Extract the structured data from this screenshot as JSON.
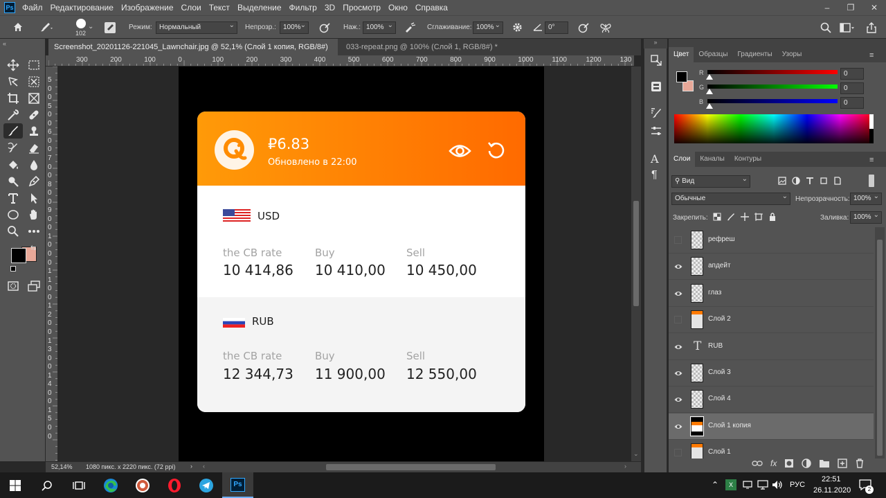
{
  "app": {
    "logo": "Ps"
  },
  "menu": [
    "Файл",
    "Редактирование",
    "Изображение",
    "Слои",
    "Текст",
    "Выделение",
    "Фильтр",
    "3D",
    "Просмотр",
    "Окно",
    "Справка"
  ],
  "options": {
    "brush_size": "102",
    "mode_label": "Режим:",
    "mode_value": "Нормальный",
    "opacity_label": "Непрозр.:",
    "opacity_value": "100%",
    "flow_label": "Наж.:",
    "flow_value": "100%",
    "smoothing_label": "Сглаживание:",
    "smoothing_value": "100%",
    "angle_value": "0°"
  },
  "tabs": [
    {
      "label": "Screenshot_20201126-221045_Lawnchair.jpg @ 52,1% (Слой 1 копия, RGB/8#) *"
    },
    {
      "label": "033-repeat.png @ 100% (Слой 1, RGB/8#) *"
    }
  ],
  "ruler": {
    "h_ticks": [
      "300",
      "200",
      "100",
      "0",
      "100",
      "200",
      "300",
      "400",
      "500",
      "600",
      "700",
      "800",
      "900",
      "1000",
      "1100",
      "1200",
      "130"
    ],
    "v_ticks": [
      "5",
      "0",
      "0",
      "5",
      "0",
      "0",
      "6",
      "0",
      "0",
      "7",
      "0",
      "0",
      "8",
      "0",
      "0",
      "9",
      "0",
      "0",
      "1",
      "0",
      "0",
      "0",
      "1",
      "1",
      "0",
      "0",
      "1",
      "2",
      "0",
      "0",
      "1",
      "3",
      "0",
      "0",
      "1",
      "4",
      "0",
      "0",
      "1",
      "5",
      "0",
      "0"
    ]
  },
  "card": {
    "rate": "₽6.83",
    "updated": "Обновлено в 22:00",
    "sections": [
      {
        "currency": "USD",
        "labels": [
          "the CB rate",
          "Buy",
          "Sell"
        ],
        "values": [
          "10 414,86",
          "10 410,00",
          "10 450,00"
        ]
      },
      {
        "currency": "RUB",
        "labels": [
          "the CB rate",
          "Buy",
          "Sell"
        ],
        "values": [
          "12 344,73",
          "11 900,00",
          "12 550,00"
        ]
      }
    ]
  },
  "status": {
    "zoom": "52,14%",
    "doc_info": "1080 пикс. x 2220 пикс. (72 ppi)"
  },
  "color_panel": {
    "tabs": [
      "Цвет",
      "Образцы",
      "Градиенты",
      "Узоры"
    ],
    "channels": [
      {
        "name": "R",
        "value": "0",
        "color": "#ff0000"
      },
      {
        "name": "G",
        "value": "0",
        "color": "#00ff00"
      },
      {
        "name": "B",
        "value": "0",
        "color": "#0000ff"
      }
    ],
    "foreground": "#000000",
    "background": "#e8a898"
  },
  "layers_panel": {
    "tabs": [
      "Слои",
      "Каналы",
      "Контуры"
    ],
    "filter_value": "Вид",
    "blend_value": "Обычные",
    "opacity_label": "Непрозрачность:",
    "opacity_value": "100%",
    "lock_label": "Закрепить:",
    "fill_label": "Заливка:",
    "fill_value": "100%",
    "layers": [
      {
        "name": "рефреш",
        "visible": false,
        "type": "raster"
      },
      {
        "name": "апдейт",
        "visible": true,
        "type": "raster"
      },
      {
        "name": "глаз",
        "visible": true,
        "type": "raster"
      },
      {
        "name": "Слой 2",
        "visible": false,
        "type": "orange"
      },
      {
        "name": "RUB",
        "visible": true,
        "type": "text"
      },
      {
        "name": "Слой 3",
        "visible": true,
        "type": "raster"
      },
      {
        "name": "Слой 4",
        "visible": true,
        "type": "raster"
      },
      {
        "name": "Слой 1 копия",
        "visible": true,
        "type": "image",
        "selected": true
      },
      {
        "name": "Слой 1",
        "visible": false,
        "type": "orange"
      }
    ]
  },
  "taskbar": {
    "lang": "РУС",
    "time": "22:51",
    "date": "26.11.2020",
    "notifications": "2"
  }
}
